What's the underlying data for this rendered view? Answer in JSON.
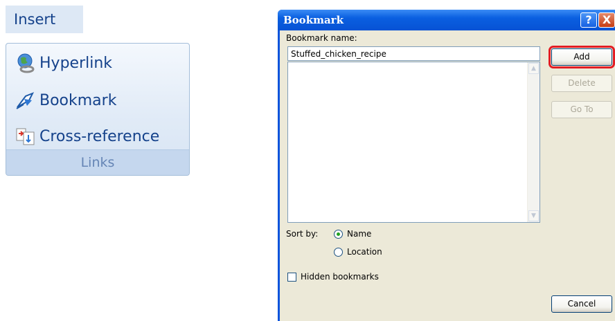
{
  "ribbon": {
    "tab_label": "Insert",
    "items": [
      {
        "label": "Hyperlink",
        "icon": "hyperlink-icon"
      },
      {
        "label": "Bookmark",
        "icon": "bookmark-icon"
      },
      {
        "label": "Cross-reference",
        "icon": "cross-reference-icon"
      }
    ],
    "group_label": "Links"
  },
  "dialog": {
    "title": "Bookmark",
    "help_symbol": "?",
    "close_symbol": "X",
    "name_label": "Bookmark name:",
    "name_value": "Stuffed_chicken_recipe",
    "buttons": {
      "add": "Add",
      "delete": "Delete",
      "goto": "Go To",
      "cancel": "Cancel"
    },
    "sort_label": "Sort by:",
    "sort_options": [
      {
        "label": "Name",
        "selected": true
      },
      {
        "label": "Location",
        "selected": false
      }
    ],
    "hidden_label": "Hidden bookmarks",
    "hidden_checked": false,
    "highlight_color": "#e31c23"
  }
}
